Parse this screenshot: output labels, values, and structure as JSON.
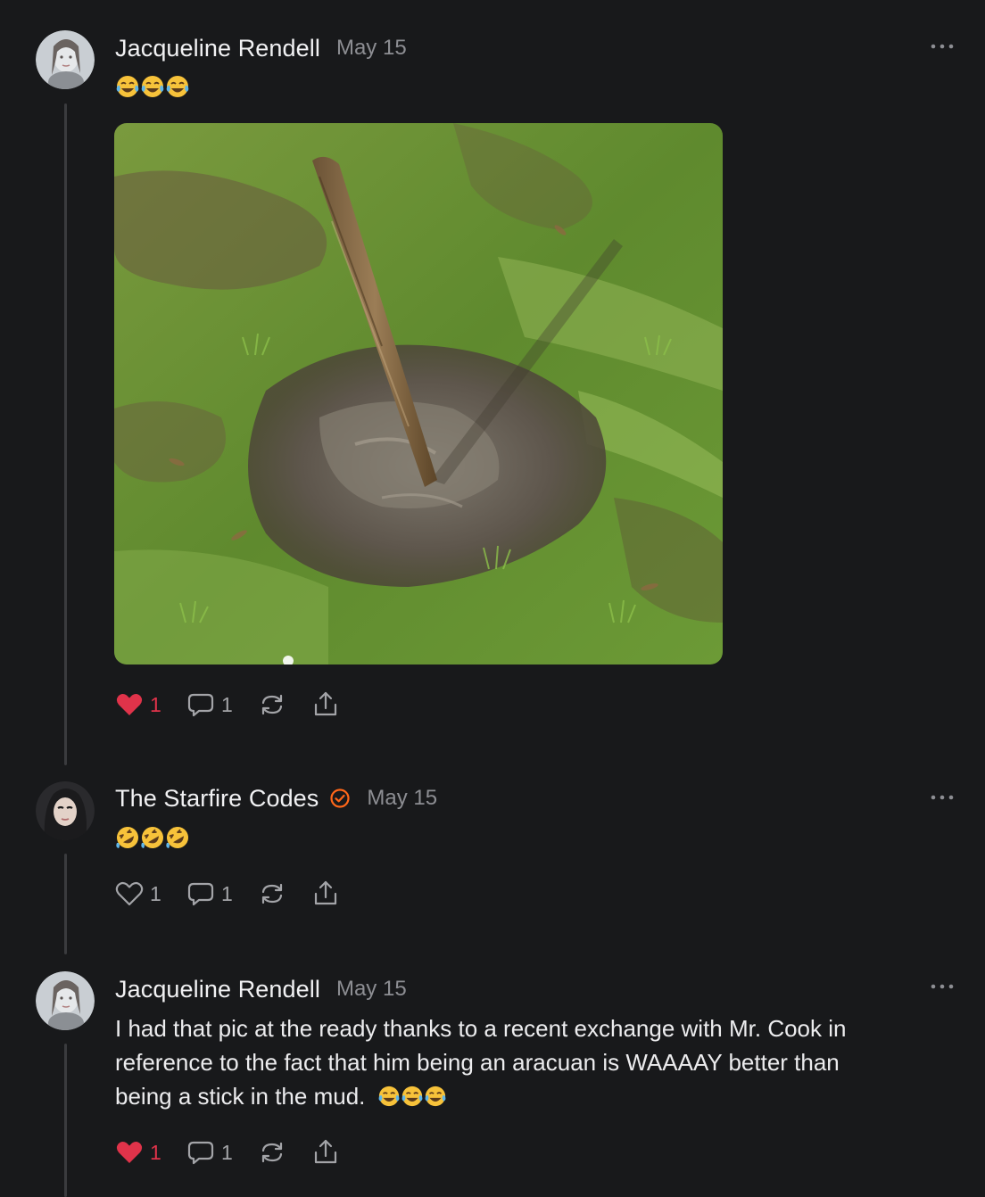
{
  "colors": {
    "background": "#18191b",
    "like_active": "#e0334a",
    "verified_badge": "#ff6719",
    "muted_text": "#8d8e93"
  },
  "posts": [
    {
      "author": "Jacqueline Rendell",
      "date": "May 15",
      "emoji_text": "😂😂😂",
      "emojis": [
        "face-with-tears-of-joy",
        "face-with-tears-of-joy",
        "face-with-tears-of-joy"
      ],
      "has_image": true,
      "image_description_icon": "muddy-stick-photo",
      "liked": true,
      "like_count": "1",
      "comment_count": "1",
      "restack_icon": "restack-icon",
      "share_icon": "share-icon"
    },
    {
      "author": "The Starfire Codes",
      "verified": true,
      "date": "May 15",
      "emoji_text": "🤣🤣🤣",
      "emojis": [
        "rolling-on-floor-laughing",
        "rolling-on-floor-laughing",
        "rolling-on-floor-laughing"
      ],
      "liked": false,
      "like_count": "1",
      "comment_count": "1"
    },
    {
      "author": "Jacqueline Rendell",
      "date": "May 15",
      "text_lines": [
        "I had that pic at the ready thanks to a recent exchange with Mr. Cook in",
        "reference to the fact that him being an aracuan is WAAAAY better than",
        "being a stick in the mud."
      ],
      "trailing_emojis": [
        "face-with-tears-of-joy",
        "face-with-tears-of-joy",
        "face-with-tears-of-joy"
      ],
      "liked": true,
      "like_count": "1",
      "comment_count": "1"
    }
  ]
}
